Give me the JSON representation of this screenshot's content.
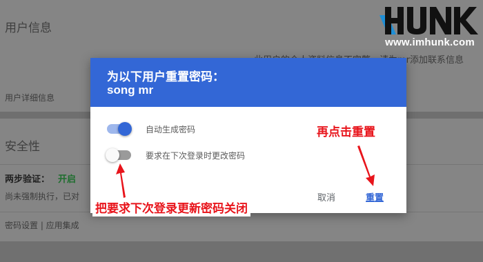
{
  "background": {
    "user_info_heading": "用户信息",
    "info_notice": "此用户的个人资料信息不完整。请为mr添加联系信息",
    "user_details_link": "用户详细信息",
    "security_heading": "安全性",
    "two_step_label": "两步验证：",
    "two_step_status": "开启",
    "enforcement_text": "尚未强制执行，已对",
    "bottom_links": "密码设置 | 应用集成"
  },
  "logo": {
    "brand": "HUNK",
    "url": "www.imhunk.com"
  },
  "dialog": {
    "title": "为以下用户重置密码：",
    "user_name": "song mr",
    "auto_generate_label": "自动生成密码",
    "auto_generate_on": true,
    "require_change_label": "要求在下次登录时更改密码",
    "require_change_on": false,
    "cancel_label": "取消",
    "reset_label": "重置"
  },
  "annotations": {
    "click_reset": "再点击重置",
    "turn_off": "把要求下次登录更新密码关闭"
  },
  "colors": {
    "primary": "#3367d6",
    "annotation": "#e8141b",
    "status_on": "#1e8e3e"
  }
}
